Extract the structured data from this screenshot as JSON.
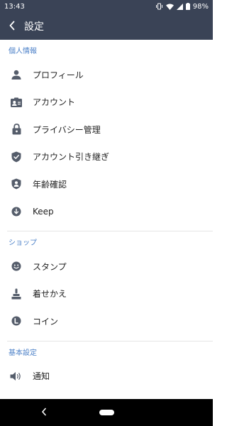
{
  "status_bar": {
    "time": "13:43",
    "battery": "98%"
  },
  "app_bar": {
    "title": "設定"
  },
  "sections": {
    "personal": {
      "header": "個人情報",
      "items": [
        {
          "label": "プロフィール",
          "icon": "person-icon"
        },
        {
          "label": "アカウント",
          "icon": "account-card-icon"
        },
        {
          "label": "プライバシー管理",
          "icon": "lock-icon"
        },
        {
          "label": "アカウント引き継ぎ",
          "icon": "shield-check-icon"
        },
        {
          "label": "年齢確認",
          "icon": "shield-person-icon"
        },
        {
          "label": "Keep",
          "icon": "keep-download-icon"
        }
      ]
    },
    "shop": {
      "header": "ショップ",
      "items": [
        {
          "label": "スタンプ",
          "icon": "smiley-icon"
        },
        {
          "label": "着せかえ",
          "icon": "brush-icon"
        },
        {
          "label": "コイン",
          "icon": "coin-icon"
        }
      ]
    },
    "basic": {
      "header": "基本設定",
      "items": [
        {
          "label": "通知",
          "icon": "speaker-icon"
        }
      ]
    }
  },
  "colors": {
    "app_bar": "#3a4356",
    "section_header": "#4a7fc7",
    "icon": "#555d6b"
  }
}
